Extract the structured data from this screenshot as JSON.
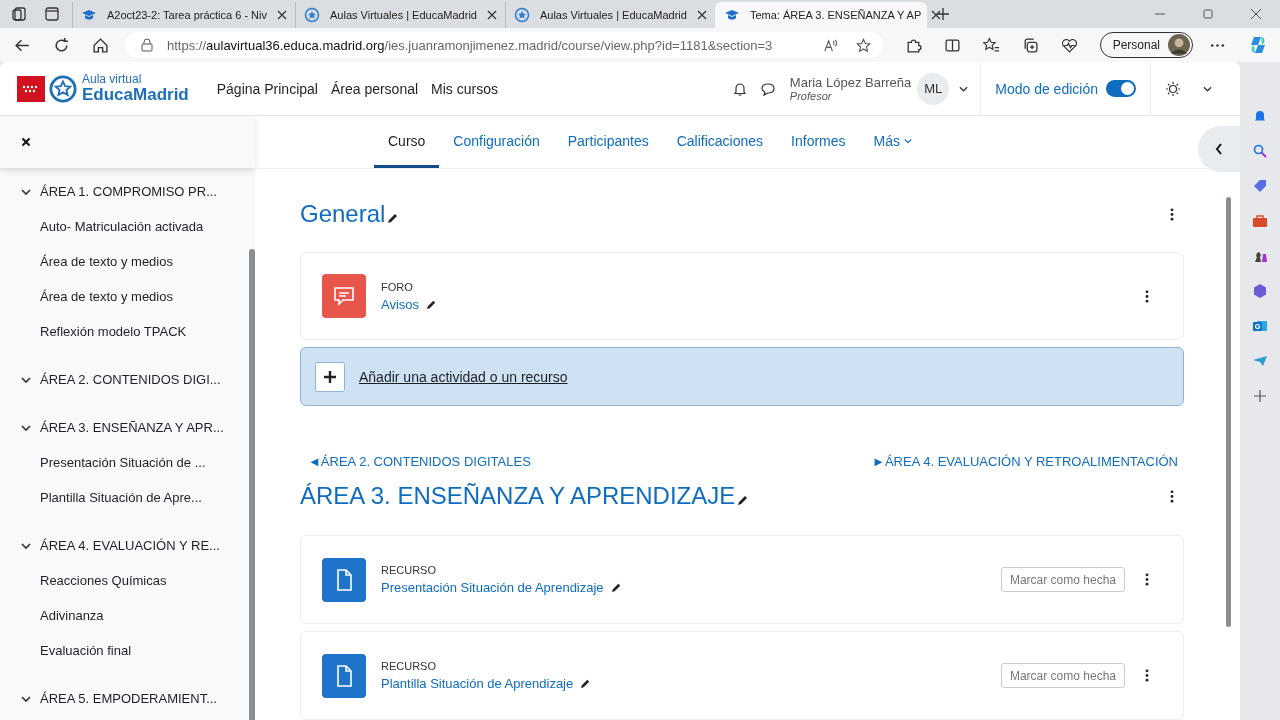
{
  "browser": {
    "tabs": [
      {
        "title": "A2oct23-2: Tarea práctica 6 - Niv",
        "kind": "course",
        "selected": false
      },
      {
        "title": "Aulas Virtuales | EducaMadrid",
        "kind": "portal",
        "selected": false
      },
      {
        "title": "Aulas Virtuales | EducaMadrid",
        "kind": "portal",
        "selected": false
      },
      {
        "title": "Tema: ÁREA 3. ENSEÑANZA Y AP",
        "kind": "course",
        "selected": true
      }
    ],
    "url_prefix": "https://",
    "url_host": "aulavirtual36.educa.madrid.org",
    "url_path": "/ies.juanramonjimenez.madrid/course/view.php?id=1181&section=3",
    "profile": "Personal"
  },
  "header": {
    "logo_top": "Aula virtual",
    "logo_bottom": "EducaMadrid",
    "nav": [
      "Página Principal",
      "Área personal",
      "Mis cursos"
    ],
    "user_name": "Maria López Barreña",
    "user_role": "Profesor",
    "initials": "ML",
    "edit_mode_label": "Modo de edición",
    "edit_mode_on": true
  },
  "drawer": {
    "sections": [
      {
        "title": "ÁREA 1. COMPROMISO PR...",
        "expanded": true,
        "children": [
          "Auto- Matriculación activada",
          "Área de texto y medios",
          "Área de texto y medios",
          "Reflexión modelo TPACK"
        ]
      },
      {
        "title": "ÁREA 2. CONTENIDOS DIGI...",
        "expanded": true
      },
      {
        "title": "ÁREA 3. ENSEÑANZA Y APR...",
        "expanded": true,
        "children": [
          "Presentación Situación de ...",
          "Plantilla Situación de Apre..."
        ]
      },
      {
        "title": "ÁREA 4. EVALUACIÓN Y RE...",
        "expanded": true,
        "children": [
          "Reacciones Químicas",
          "Adivinanza",
          "Evaluación final"
        ]
      },
      {
        "title": "ÁREA 5. EMPODERAMIENT...",
        "expanded": true
      }
    ]
  },
  "course_nav": [
    {
      "label": "Curso",
      "selected": true,
      "kind": "link"
    },
    {
      "label": "Configuración",
      "selected": false,
      "kind": "link"
    },
    {
      "label": "Participantes",
      "selected": false,
      "kind": "link"
    },
    {
      "label": "Calificaciones",
      "selected": false,
      "kind": "link"
    },
    {
      "label": "Informes",
      "selected": false,
      "kind": "link"
    },
    {
      "label": "Más",
      "selected": false,
      "kind": "menu"
    }
  ],
  "general": {
    "title": "General",
    "activities": [
      {
        "kind": "forum",
        "type_label": "FORO",
        "name": "Avisos"
      }
    ],
    "add_label": "Añadir una actividad o un recurso"
  },
  "prev_link": "◄ÁREA 2. CONTENIDOS DIGITALES",
  "next_link": "►ÁREA 4. EVALUACIÓN Y RETROALIMENTACIÓN",
  "section": {
    "title": "ÁREA 3. ENSEÑANZA Y APRENDIZAJE",
    "activities": [
      {
        "kind": "resource",
        "type_label": "RECURSO",
        "name": "Presentación Situación de Aprendizaje",
        "completion": "Marcar como hecha"
      },
      {
        "kind": "resource",
        "type_label": "RECURSO",
        "name": "Plantilla Situación de Aprendizaje",
        "completion": "Marcar como hecha"
      }
    ]
  }
}
